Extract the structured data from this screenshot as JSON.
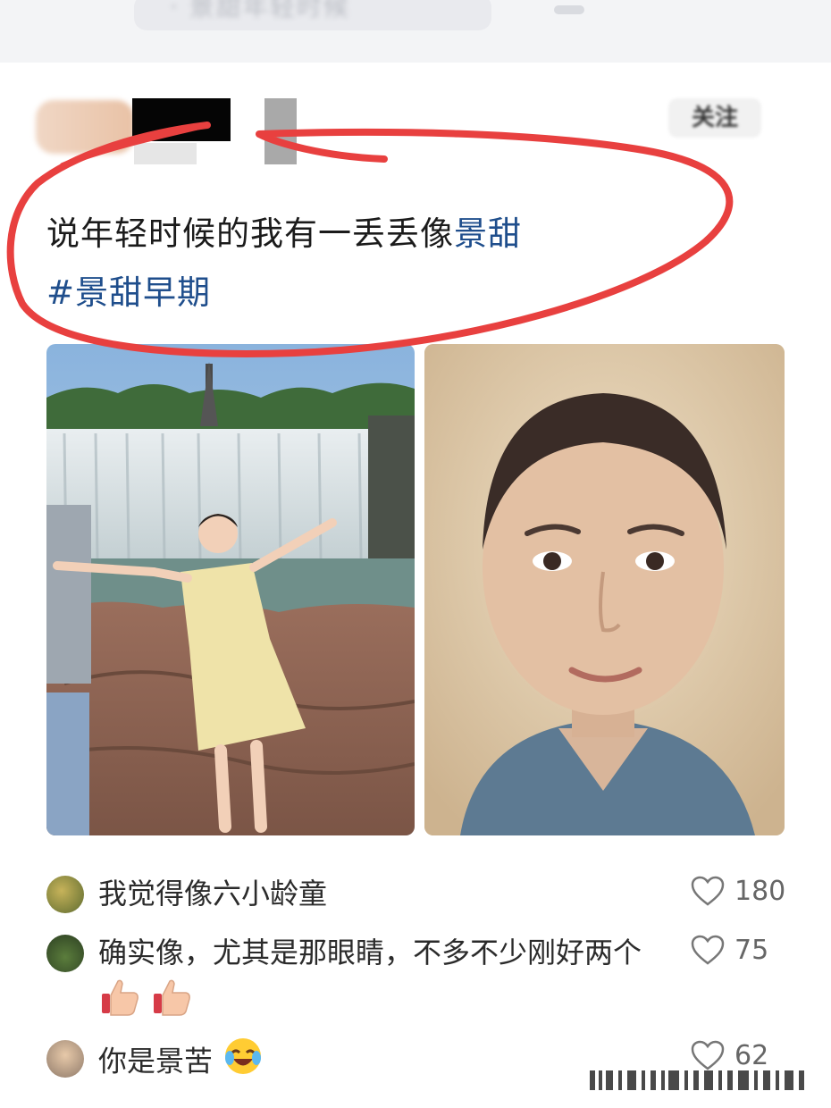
{
  "top_bar": {
    "blurred_text": "· 景甜年轻时候",
    "tab_indicator": ""
  },
  "post": {
    "follow_button": "关注",
    "caption": {
      "text": "说年轻时候的我有一丢丢像",
      "highlight": "景甜"
    },
    "hashtag": "#景甜早期",
    "images": [
      {
        "icon": "waterfall-photo"
      },
      {
        "icon": "portrait-photo"
      }
    ]
  },
  "comments": [
    {
      "text": "我觉得像六小龄童",
      "likes": "180",
      "avatar": "avatar-forest"
    },
    {
      "text": "确实像，尤其是那眼睛，不多不少刚好两个",
      "emoji": [
        "thumbs-up",
        "thumbs-up"
      ],
      "likes": "75",
      "avatar": "avatar-garden"
    },
    {
      "text": "你是景苦",
      "emoji": [
        "laughing-crying"
      ],
      "likes": "62",
      "avatar": "avatar-person"
    }
  ],
  "colors": {
    "accent": "#1f4e8c",
    "annotation": "#e8403f"
  }
}
